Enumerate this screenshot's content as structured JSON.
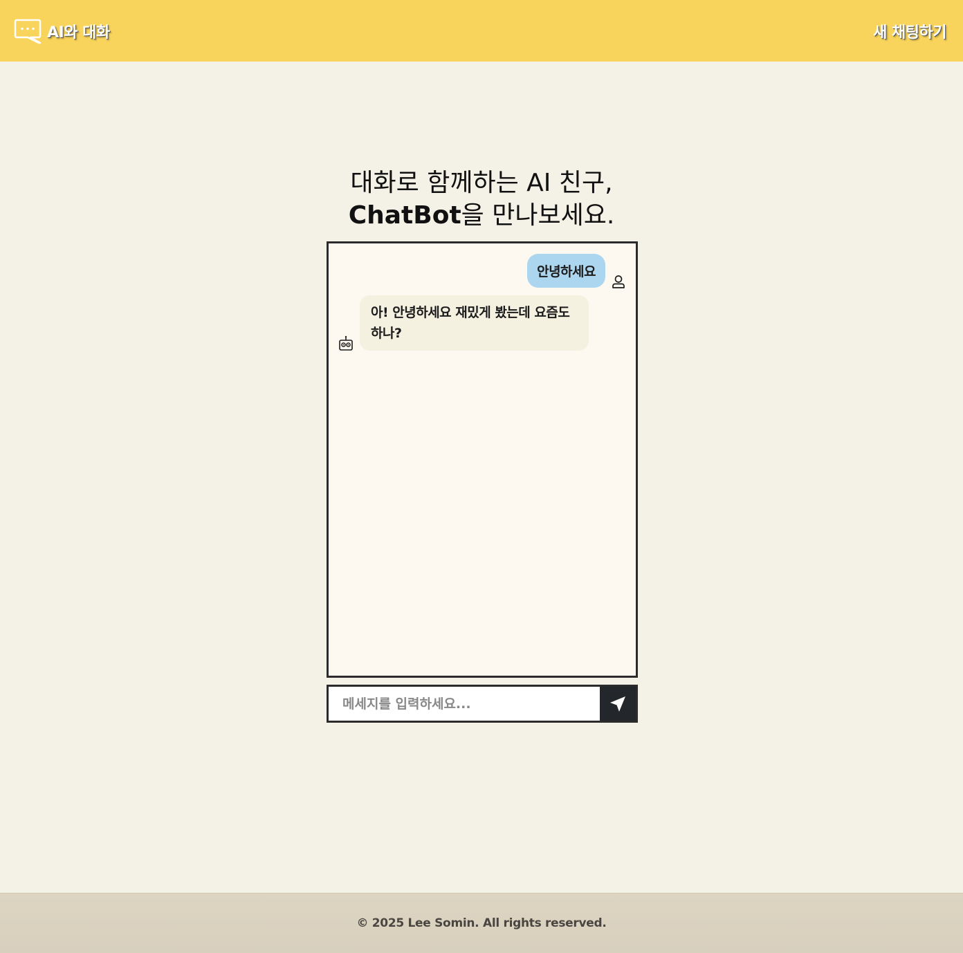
{
  "header": {
    "brand_icon": "chat-bubble-icon",
    "title": "AI와 대화",
    "new_chat_label": "새 채팅하기"
  },
  "headline": {
    "line1": "대화로 함께하는 AI 친구,",
    "brand_word": "ChatBot",
    "line2_rest": "을 만나보세요."
  },
  "chat": {
    "messages": [
      {
        "role": "user",
        "text": "안녕하세요",
        "icon": "user-icon"
      },
      {
        "role": "bot",
        "text": "아! 안녕하세요 재밌게 봤는데 요즘도 하나?",
        "icon": "robot-icon"
      }
    ]
  },
  "input": {
    "placeholder": "메세지를 입력하세요...",
    "value": "",
    "send_icon": "send-arrow-icon"
  },
  "footer": {
    "text": "© 2025 Lee Somin. All rights reserved."
  },
  "colors": {
    "header_bg": "#f8d45c",
    "page_bg": "#f4f1e6",
    "user_bubble": "#acd6ef",
    "bot_bubble": "#f4f1e0",
    "send_button": "#23262b",
    "footer_bg": "#ddd5c2"
  }
}
